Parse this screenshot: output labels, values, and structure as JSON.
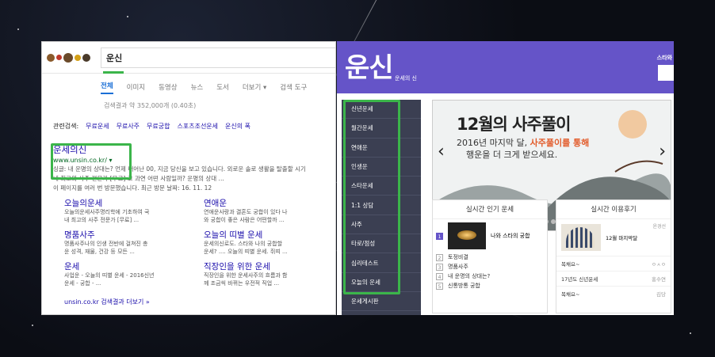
{
  "google": {
    "query": "운신",
    "tabs": [
      "전체",
      "이미지",
      "동영상",
      "뉴스",
      "도서",
      "더보기 ▾",
      "검색 도구"
    ],
    "stats": "검색결과 약 352,000개 (0.40초)",
    "related_label": "관련검색:",
    "related": [
      "무료운세",
      "무료사주",
      "무료궁합",
      "스포츠조선운세",
      "운신의 폭"
    ],
    "result": {
      "title": "운세의신",
      "url": "www.unsin.co.kr/ ▾",
      "snippet1": "싱글: 내 운명의 상대는? 언제 태어난 00, 지금 당신을 보고 있습니다. 외로운 솔로 생활을 탈출할 시기",
      "snippet2": "내 최고의 사주 전문가 [무료] 고 과연 어떤 사람일까? 운명의 상대 ...",
      "snippet3": "이 페이지를 여러 번 방문했습니다. 최근 방문 날짜: 16. 11. 12"
    },
    "sitelinks": [
      {
        "title": "오늘의운세",
        "desc1": "오늘의운세사주명리학에 기초하여 국",
        "desc2": "내 최고의 사주 전문가 [무료] ..."
      },
      {
        "title": "연애운",
        "desc1": "연애운사랑과 결혼도 궁합이 있다 나",
        "desc2": "와 궁합이 좋은 사람은 어떤할까 ..."
      },
      {
        "title": "명품사주",
        "desc1": "명품사주나의 인생 전반에 걸쳐진 총",
        "desc2": "운 성격, 재물, 건강 등 모든 ..."
      },
      {
        "title": "오늘의 띠별 운세",
        "desc1": "운세의신로도. 스타와 나의 궁합할",
        "desc2": "운세? .... 오늘의 띠별 운세. 쥐띠 ..."
      },
      {
        "title": "운세",
        "desc1": "사업운 - 오늘의 띠별 운세 - 2016신년",
        "desc2": "운세 - 궁합 - ..."
      },
      {
        "title": "직장인을 위한 운세",
        "desc1": "직장인을 위한 운세사주의 흐름과 함",
        "desc2": "께 조금씩 바뀌는 우전적 직업 ..."
      }
    ],
    "more": "unsin.co.kr 검색결과 더보기 »"
  },
  "unsin": {
    "logo": "운신",
    "logo_sub": "운세의 신",
    "top_right": "스타와",
    "nav": [
      "신년운세",
      "월간운세",
      "연애운",
      "인생운",
      "스타운세",
      "1:1 상담",
      "사주",
      "타로/점성",
      "심리테스트",
      "오늘의 운세",
      "운세게시판"
    ],
    "banner": {
      "title": "12월의 사주풀이",
      "line1_pre": "2016년 마지막 달, ",
      "line1_em": "사주풀이를 통해",
      "line2": "행운을 더 크게 받으세요."
    },
    "popular": {
      "title": "실시간 인기 운세",
      "items": [
        "나와 스타의 궁합",
        "토정비결",
        "명품사주",
        "내 운명의 상대는?",
        "신통방통 궁합"
      ]
    },
    "reviews": {
      "title": "실시간 이용후기",
      "feature_caption": "12월 마지막달",
      "feature_who": "윤경선",
      "rows": [
        {
          "text": "복채요~",
          "who": "ㅇㅅㅇ"
        },
        {
          "text": "17년도 신년운세",
          "who": "홍수연"
        },
        {
          "text": "복채요~",
          "who": "김당"
        }
      ]
    }
  },
  "colors": {
    "highlight_green": "#3bb54a",
    "unsin_purple": "#6554c8",
    "google_link": "#1a0dab"
  }
}
